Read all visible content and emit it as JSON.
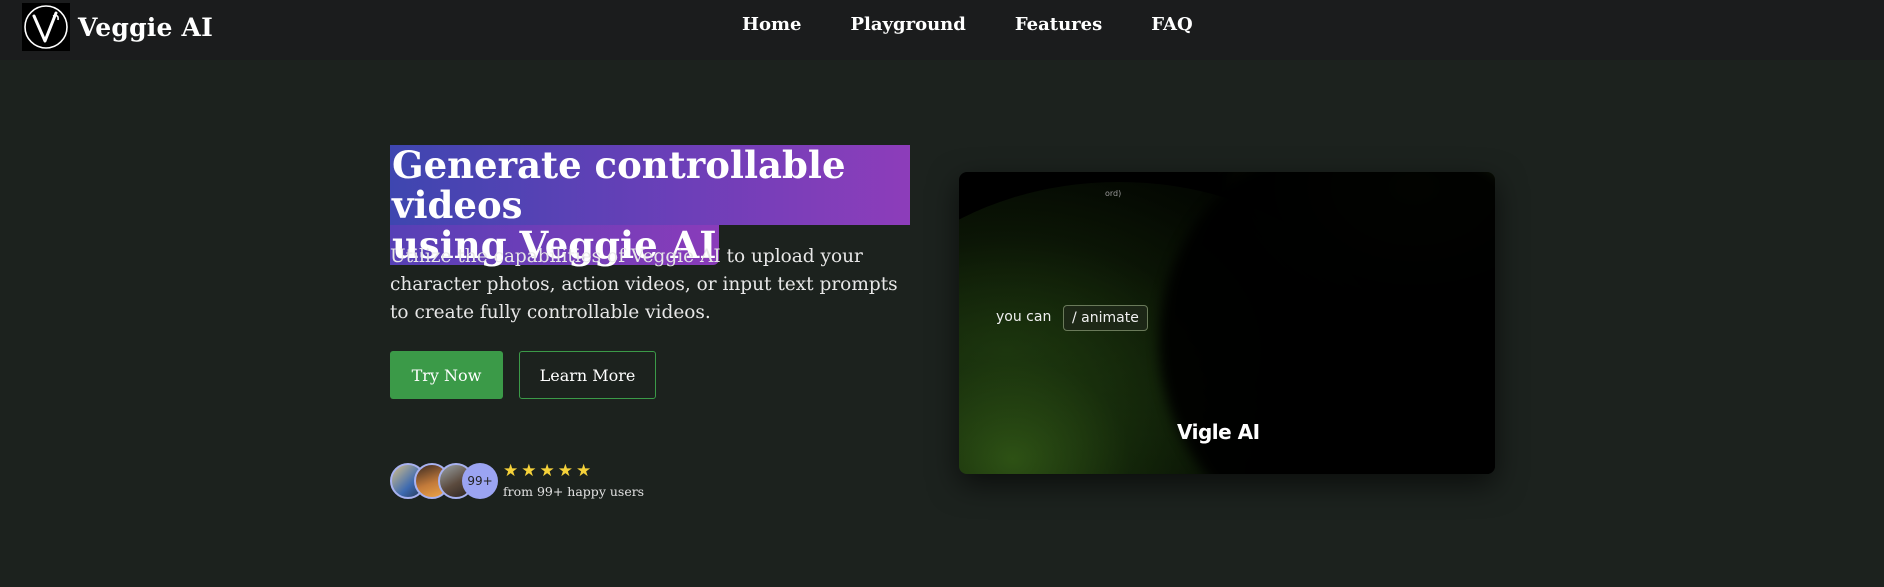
{
  "brand": {
    "name": "Veggie AI",
    "logo_icon": "v-logo-icon"
  },
  "nav": {
    "links": [
      "Home",
      "Playground",
      "Features",
      "FAQ"
    ]
  },
  "hero": {
    "headline_line1": "Generate controllable videos",
    "headline_line2": "using Veggie AI",
    "subtext": "Utilize the capabilities of Veggie AI to upload your character photos, action videos, or input text prompts to create fully controllable videos.",
    "try_label": "Try Now",
    "learn_label": "Learn More",
    "avatar_count": "99+",
    "stars": "★★★★★",
    "rating_value": 5,
    "happy_users": "from 99+ happy users"
  },
  "video": {
    "tiny_text": "ord)",
    "you_can": "you can",
    "command": "/ animate",
    "watermark": "Vigle AI"
  },
  "colors": {
    "accent_green": "#3b9a48",
    "gradient_start": "#3e46b0",
    "gradient_end": "#8d3dba",
    "star": "#f5d23a"
  }
}
